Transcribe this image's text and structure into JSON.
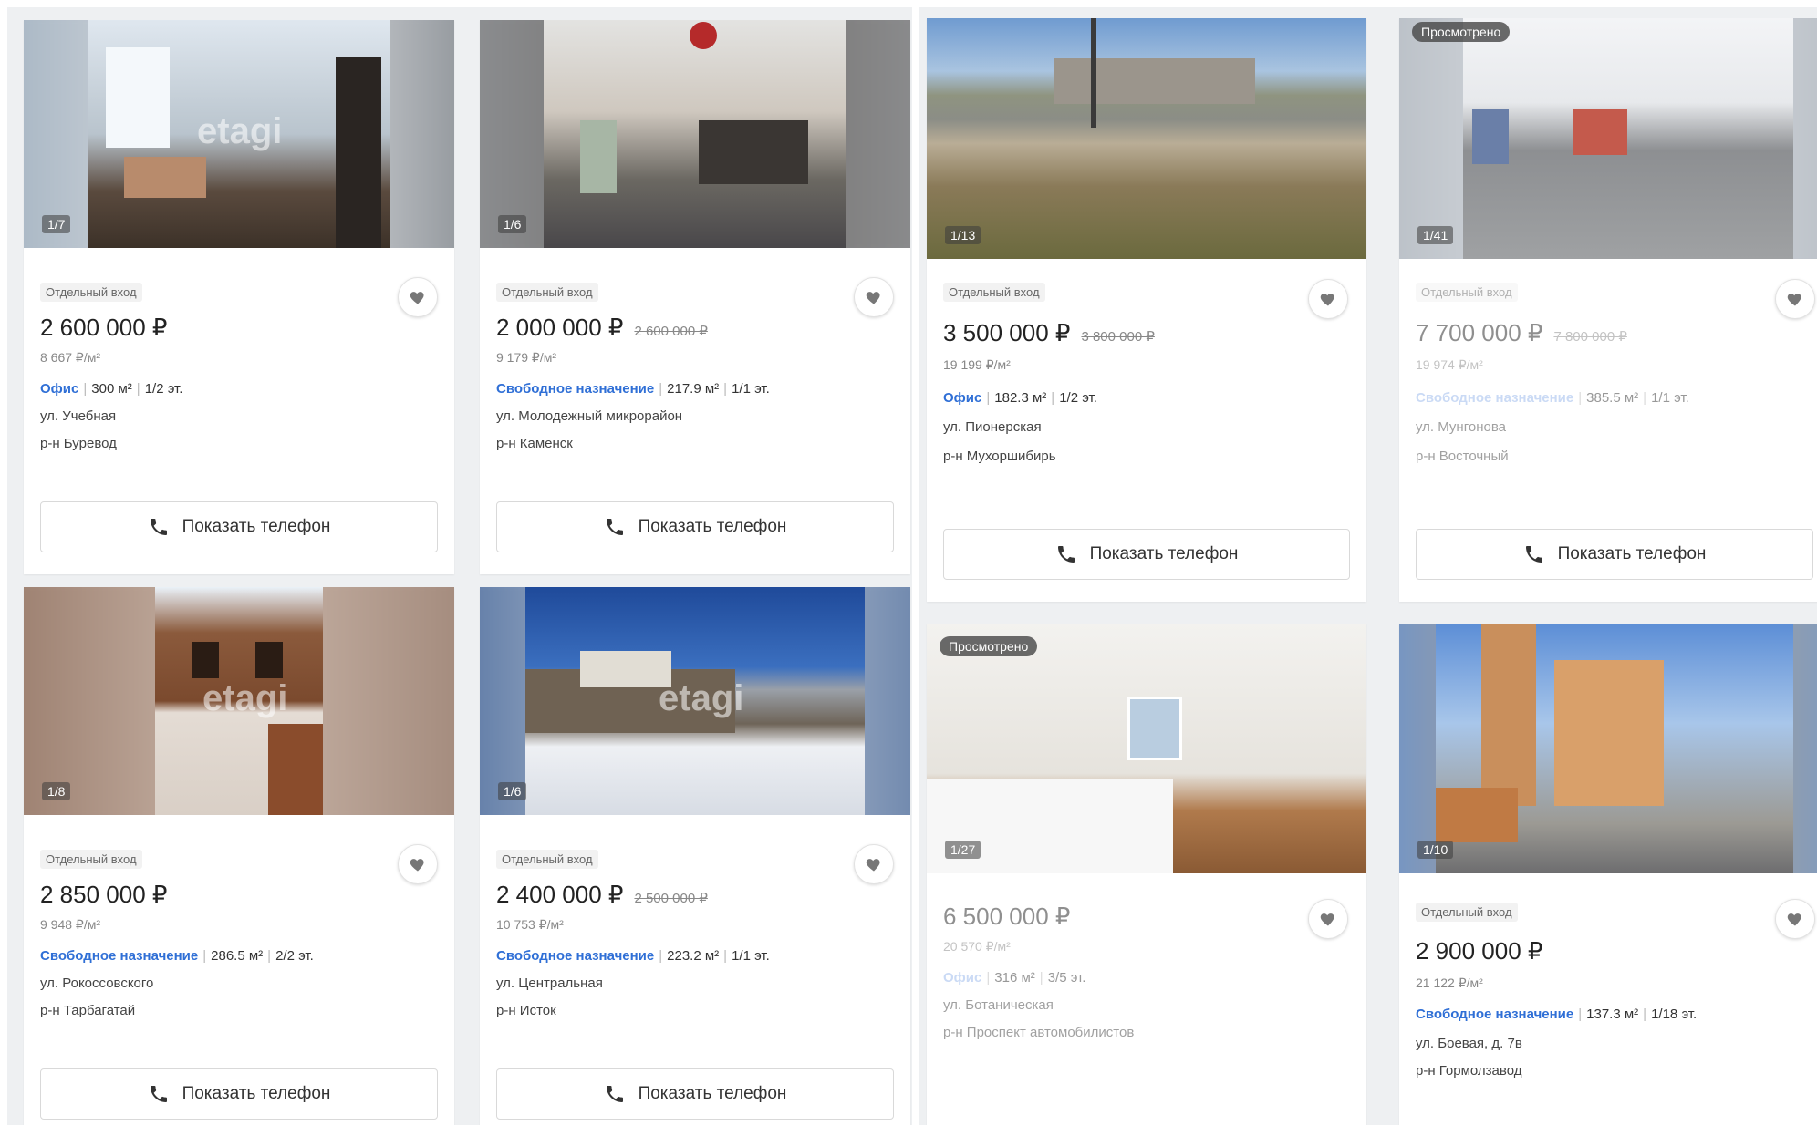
{
  "colors": {
    "accent": "#2f6fd6",
    "panel_bg": "#eef0f2",
    "fav_heart": "#777777"
  },
  "phone_label": "Показать телефон",
  "viewed_label": "Просмотрено",
  "listings": [
    {
      "counter": "1/7",
      "tag": "Отдельный вход",
      "price": "2 600 000 ₽",
      "old_price": "",
      "price_per_m2": "8 667 ₽/м²",
      "type": "Офис",
      "area": "300 м²",
      "floor": "1/2 эт.",
      "street": "ул. Учебная",
      "district": "р-н Буревод",
      "watermark": "etagi",
      "viewed": false,
      "faded": false
    },
    {
      "counter": "1/6",
      "tag": "Отдельный вход",
      "price": "2 000 000 ₽",
      "old_price": "2 600 000 ₽",
      "price_per_m2": "9 179 ₽/м²",
      "type": "Свободное назначение",
      "area": "217.9 м²",
      "floor": "1/1 эт.",
      "street": "ул. Молодежный микрорайон",
      "district": "р-н Каменск",
      "watermark": "",
      "viewed": false,
      "faded": false
    },
    {
      "counter": "1/8",
      "tag": "Отдельный вход",
      "price": "2 850 000 ₽",
      "old_price": "",
      "price_per_m2": "9 948 ₽/м²",
      "type": "Свободное назначение",
      "area": "286.5 м²",
      "floor": "2/2 эт.",
      "street": "ул. Рокоссовского",
      "district": "р-н Тарбагатай",
      "watermark": "etagi",
      "viewed": false,
      "faded": false
    },
    {
      "counter": "1/6",
      "tag": "Отдельный вход",
      "price": "2 400 000 ₽",
      "old_price": "2 500 000 ₽",
      "price_per_m2": "10 753 ₽/м²",
      "type": "Свободное назначение",
      "area": "223.2 м²",
      "floor": "1/1 эт.",
      "street": "ул. Центральная",
      "district": "р-н Исток",
      "watermark": "etagi",
      "viewed": false,
      "faded": false
    },
    {
      "counter": "1/13",
      "tag": "Отдельный вход",
      "price": "3 500 000 ₽",
      "old_price": "3 800 000 ₽",
      "price_per_m2": "19 199 ₽/м²",
      "type": "Офис",
      "area": "182.3 м²",
      "floor": "1/2 эт.",
      "street": "ул. Пионерская",
      "district": "р-н Мухоршибирь",
      "watermark": "",
      "viewed": false,
      "faded": false
    },
    {
      "counter": "1/41",
      "tag": "Отдельный вход",
      "price": "7 700 000 ₽",
      "old_price": "7 800 000 ₽",
      "price_per_m2": "19 974 ₽/м²",
      "type": "Свободное назначение",
      "area": "385.5 м²",
      "floor": "1/1 эт.",
      "street": "ул. Мунгонова",
      "district": "р-н Восточный",
      "watermark": "",
      "viewed": true,
      "faded": true
    },
    {
      "counter": "1/27",
      "tag": "",
      "price": "6 500 000 ₽",
      "old_price": "",
      "price_per_m2": "20 570 ₽/м²",
      "type": "Офис",
      "area": "316 м²",
      "floor": "3/5 эт.",
      "street": "ул. Ботаническая",
      "district": "р-н Проспект автомобилистов",
      "watermark": "",
      "viewed": true,
      "faded": true
    },
    {
      "counter": "1/10",
      "tag": "Отдельный вход",
      "price": "2 900 000 ₽",
      "old_price": "",
      "price_per_m2": "21 122 ₽/м²",
      "type": "Свободное назначение",
      "area": "137.3 м²",
      "floor": "1/18 эт.",
      "street": "ул. Боевая, д. 7в",
      "district": "р-н Гормолзавод",
      "watermark": "",
      "viewed": false,
      "faded": false
    }
  ]
}
